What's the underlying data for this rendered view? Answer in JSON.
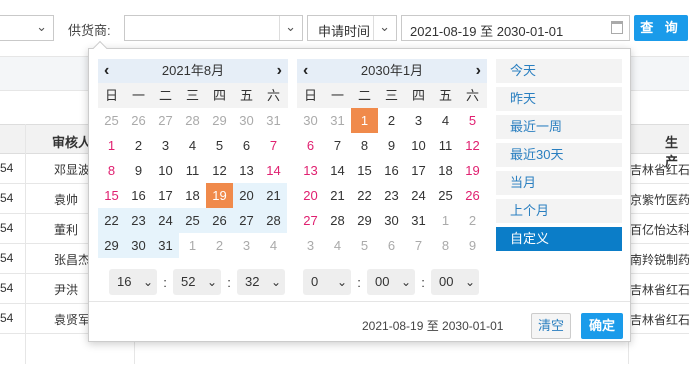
{
  "filter": {
    "supplier_label": "供货商:",
    "supplier_value": "",
    "time_type": "申请时间",
    "date_range": "2021-08-19 至 2030-01-01",
    "query_label": "查 询"
  },
  "table": {
    "headers": {
      "reviewer": "审核人",
      "producer": "生产"
    },
    "rows": [
      {
        "left": "54",
        "reviewer": "邓显波",
        "producer": "吉林省红石药"
      },
      {
        "left": "54",
        "reviewer": "袁帅",
        "producer": "京紫竹医药"
      },
      {
        "left": "54",
        "reviewer": "董利",
        "producer": "百亿怡达科"
      },
      {
        "left": "54",
        "reviewer": "张昌杰",
        "producer": "南羚锐制药"
      },
      {
        "left": "54",
        "reviewer": "尹洪",
        "producer": "吉林省红石药"
      },
      {
        "left": "54",
        "reviewer": "袁贤军",
        "producer": "吉林省红石药"
      }
    ]
  },
  "picker": {
    "weekdays": [
      "日",
      "一",
      "二",
      "三",
      "四",
      "五",
      "六"
    ],
    "left_calendar": {
      "title": "2021年8月",
      "weeks": [
        [
          {
            "d": "25",
            "t": "other"
          },
          {
            "d": "26",
            "t": "other"
          },
          {
            "d": "27",
            "t": "other"
          },
          {
            "d": "28",
            "t": "other"
          },
          {
            "d": "29",
            "t": "other"
          },
          {
            "d": "30",
            "t": "other"
          },
          {
            "d": "31",
            "t": "other"
          }
        ],
        [
          {
            "d": "1",
            "t": "holiday"
          },
          {
            "d": "2",
            "t": ""
          },
          {
            "d": "3",
            "t": ""
          },
          {
            "d": "4",
            "t": ""
          },
          {
            "d": "5",
            "t": ""
          },
          {
            "d": "6",
            "t": ""
          },
          {
            "d": "7",
            "t": "holiday"
          }
        ],
        [
          {
            "d": "8",
            "t": "holiday"
          },
          {
            "d": "9",
            "t": ""
          },
          {
            "d": "10",
            "t": ""
          },
          {
            "d": "11",
            "t": ""
          },
          {
            "d": "12",
            "t": ""
          },
          {
            "d": "13",
            "t": ""
          },
          {
            "d": "14",
            "t": "holiday"
          }
        ],
        [
          {
            "d": "15",
            "t": "holiday"
          },
          {
            "d": "16",
            "t": ""
          },
          {
            "d": "17",
            "t": ""
          },
          {
            "d": "18",
            "t": ""
          },
          {
            "d": "19",
            "t": "selected"
          },
          {
            "d": "20",
            "t": "inrange"
          },
          {
            "d": "21",
            "t": "inrange"
          }
        ],
        [
          {
            "d": "22",
            "t": "inrange"
          },
          {
            "d": "23",
            "t": "inrange"
          },
          {
            "d": "24",
            "t": "inrange"
          },
          {
            "d": "25",
            "t": "inrange"
          },
          {
            "d": "26",
            "t": "inrange"
          },
          {
            "d": "27",
            "t": "inrange"
          },
          {
            "d": "28",
            "t": "inrange"
          }
        ],
        [
          {
            "d": "29",
            "t": "inrange"
          },
          {
            "d": "30",
            "t": "inrange"
          },
          {
            "d": "31",
            "t": "inrange"
          },
          {
            "d": "1",
            "t": "other"
          },
          {
            "d": "2",
            "t": "other"
          },
          {
            "d": "3",
            "t": "other"
          },
          {
            "d": "4",
            "t": "other"
          }
        ]
      ],
      "time": {
        "hour": "16",
        "minute": "52",
        "second": "32"
      }
    },
    "right_calendar": {
      "title": "2030年1月",
      "weeks": [
        [
          {
            "d": "30",
            "t": "other"
          },
          {
            "d": "31",
            "t": "other"
          },
          {
            "d": "1",
            "t": "selected"
          },
          {
            "d": "2",
            "t": ""
          },
          {
            "d": "3",
            "t": ""
          },
          {
            "d": "4",
            "t": ""
          },
          {
            "d": "5",
            "t": "holiday"
          }
        ],
        [
          {
            "d": "6",
            "t": "holiday"
          },
          {
            "d": "7",
            "t": ""
          },
          {
            "d": "8",
            "t": ""
          },
          {
            "d": "9",
            "t": ""
          },
          {
            "d": "10",
            "t": ""
          },
          {
            "d": "11",
            "t": ""
          },
          {
            "d": "12",
            "t": "holiday"
          }
        ],
        [
          {
            "d": "13",
            "t": "holiday"
          },
          {
            "d": "14",
            "t": ""
          },
          {
            "d": "15",
            "t": ""
          },
          {
            "d": "16",
            "t": ""
          },
          {
            "d": "17",
            "t": ""
          },
          {
            "d": "18",
            "t": ""
          },
          {
            "d": "19",
            "t": "holiday"
          }
        ],
        [
          {
            "d": "20",
            "t": "holiday"
          },
          {
            "d": "21",
            "t": ""
          },
          {
            "d": "22",
            "t": ""
          },
          {
            "d": "23",
            "t": ""
          },
          {
            "d": "24",
            "t": ""
          },
          {
            "d": "25",
            "t": ""
          },
          {
            "d": "26",
            "t": "holiday"
          }
        ],
        [
          {
            "d": "27",
            "t": "holiday"
          },
          {
            "d": "28",
            "t": ""
          },
          {
            "d": "29",
            "t": ""
          },
          {
            "d": "30",
            "t": ""
          },
          {
            "d": "31",
            "t": ""
          },
          {
            "d": "1",
            "t": "other"
          },
          {
            "d": "2",
            "t": "other"
          }
        ],
        [
          {
            "d": "3",
            "t": "other"
          },
          {
            "d": "4",
            "t": "other"
          },
          {
            "d": "5",
            "t": "other"
          },
          {
            "d": "6",
            "t": "other"
          },
          {
            "d": "7",
            "t": "other"
          },
          {
            "d": "8",
            "t": "other"
          },
          {
            "d": "9",
            "t": "other"
          }
        ]
      ],
      "time": {
        "hour": "0",
        "minute": "00",
        "second": "00"
      }
    },
    "quick_ranges": [
      "今天",
      "昨天",
      "最近一周",
      "最近30天",
      "当月",
      "上个月",
      "自定义"
    ],
    "active_quick": 6,
    "footer_range": "2021-08-19 至 2030-01-01",
    "clear_label": "清空",
    "ok_label": "确定"
  },
  "colors": {
    "accent": "#1a9bea",
    "selected_day": "#f08a4b",
    "range_bg": "#e6f3fb",
    "holiday_text": "#e02070",
    "active_quick": "#0b7dc8"
  }
}
